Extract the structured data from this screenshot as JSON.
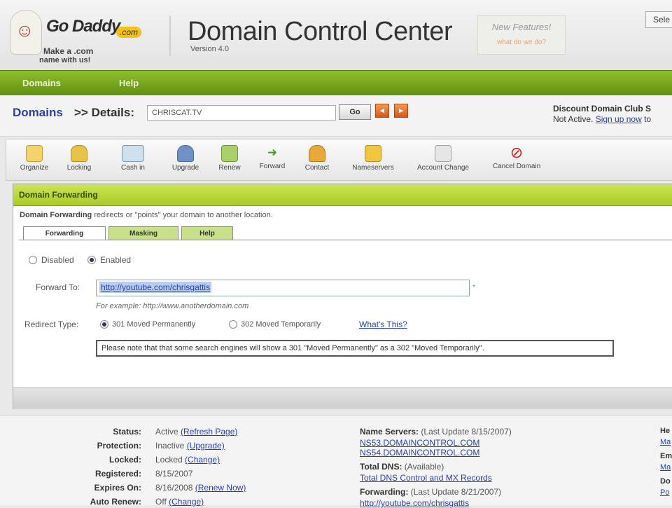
{
  "header": {
    "logo_text": "Go Daddy",
    "logo_suffix": ".com",
    "logo_tagline_1": "Make a .com",
    "logo_tagline_2": "name with us!",
    "app_title": "Domain Control Center",
    "app_version": "Version 4.0",
    "new_features_label": "New Features!",
    "new_features_link": "what do we do?",
    "select_label": "Sele"
  },
  "nav": {
    "items": [
      "Domains",
      "Help"
    ]
  },
  "breadcrumb": {
    "domains_label": "Domains",
    "details_label": ">> Details:",
    "domain_value": "CHRISCAT.TV",
    "go_label": "Go"
  },
  "club": {
    "title": "Discount Domain Club S",
    "status": "Not Active.",
    "signup_link": "Sign up now",
    "signup_suffix": " to"
  },
  "toolbar": {
    "items": [
      {
        "label": "Organize",
        "icon": "folder-icon"
      },
      {
        "label": "Locking",
        "icon": "lock-icon"
      },
      {
        "label": "Cash in",
        "icon": "cash-in-icon"
      },
      {
        "label": "Upgrade",
        "icon": "upgrade-icon"
      },
      {
        "label": "Renew",
        "icon": "renew-icon"
      },
      {
        "label": "Forward",
        "icon": "forward-icon"
      },
      {
        "label": "Contact",
        "icon": "contact-icon"
      },
      {
        "label": "Nameservers",
        "icon": "nameservers-icon"
      },
      {
        "label": "Account Change",
        "icon": "account-change-icon"
      },
      {
        "label": "Cancel Domain",
        "icon": "cancel-icon"
      }
    ]
  },
  "panel": {
    "title": "Domain Forwarding",
    "description_bold": "Domain Forwarding",
    "description_rest": " redirects or \"points\" your domain to another location.",
    "tabs": [
      "Forwarding",
      "Masking",
      "Help"
    ],
    "status_options": {
      "disabled": "Disabled",
      "enabled": "Enabled",
      "selected": "enabled"
    },
    "forward_label": "Forward To:",
    "forward_value": "http://youtube.com/chrisgattis",
    "required_mark": "*",
    "example_text": "For example: http://www.anotherdomain.com",
    "redirect_label": "Redirect Type:",
    "redirect_301": "301 Moved Permanently",
    "redirect_302": "302 Moved Temporarily",
    "redirect_selected": "301",
    "whats_this": "What's This?",
    "note": "Please note that that some search engines will show a 301 \"Moved Permanently\" as a 302 \"Moved Temporarily\"."
  },
  "info": {
    "left": [
      {
        "label": "Status:",
        "value": "Active",
        "link": "(Refresh Page)"
      },
      {
        "label": "Protection:",
        "value": "Inactive",
        "link": "(Upgrade)"
      },
      {
        "label": "Locked:",
        "value": "Locked",
        "link": "(Change)"
      },
      {
        "label": "Registered:",
        "value": "8/15/2007",
        "link": ""
      },
      {
        "label": "Expires On:",
        "value": "8/16/2008",
        "link": "(Renew Now)"
      },
      {
        "label": "Auto Renew:",
        "value": "Off",
        "link": "(Change)"
      }
    ],
    "name_servers_label": "Name Servers:",
    "name_servers_note": "(Last Update 8/15/2007)",
    "name_servers": [
      "NS53.DOMAINCONTROL.COM",
      "NS54.DOMAINCONTROL.COM"
    ],
    "total_dns_label": "Total DNS:",
    "total_dns_note": "(Available)",
    "total_dns_link": "Total DNS Control and MX Records",
    "forwarding_label": "Forwarding:",
    "forwarding_note": "(Last Update 8/21/2007)",
    "forwarding_link": "http://youtube.com/chrisgattis",
    "edge_labels": [
      "He",
      "Em",
      "Do"
    ],
    "edge_links": [
      "Ma",
      "Ma",
      "Po"
    ]
  },
  "colors": {
    "nav_green": "#6f9f18",
    "panel_header": "#b8d830",
    "link_blue": "#2a3fa8",
    "cancel_red": "#d42020",
    "orange_button": "#e8762e"
  }
}
